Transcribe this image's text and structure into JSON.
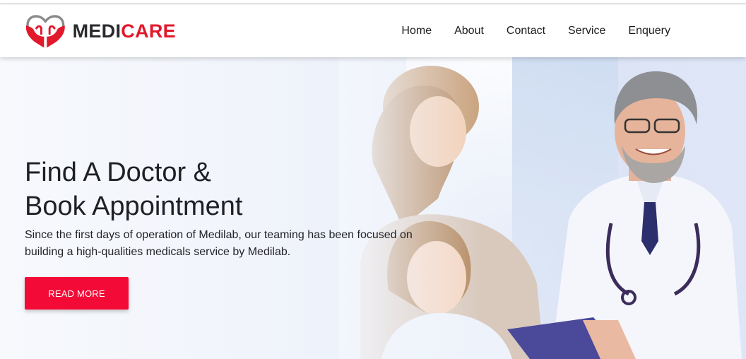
{
  "brand": {
    "part1": "MEDI",
    "part2": "CARE"
  },
  "nav": {
    "items": [
      {
        "label": "Home"
      },
      {
        "label": "About"
      },
      {
        "label": "Contact"
      },
      {
        "label": "Service"
      },
      {
        "label": "Enquery"
      }
    ]
  },
  "hero": {
    "title_line1": "Find A Doctor &",
    "title_line2": "Book Appointment",
    "description": "Since the first days of operation of Medilab, our teaming has been focused on building a high-qualities medicals service by Medilab.",
    "button_label": "READ MORE"
  },
  "colors": {
    "accent": "#f40a36",
    "brand_red": "#e2182b",
    "brand_dark": "#2a2a2e"
  }
}
